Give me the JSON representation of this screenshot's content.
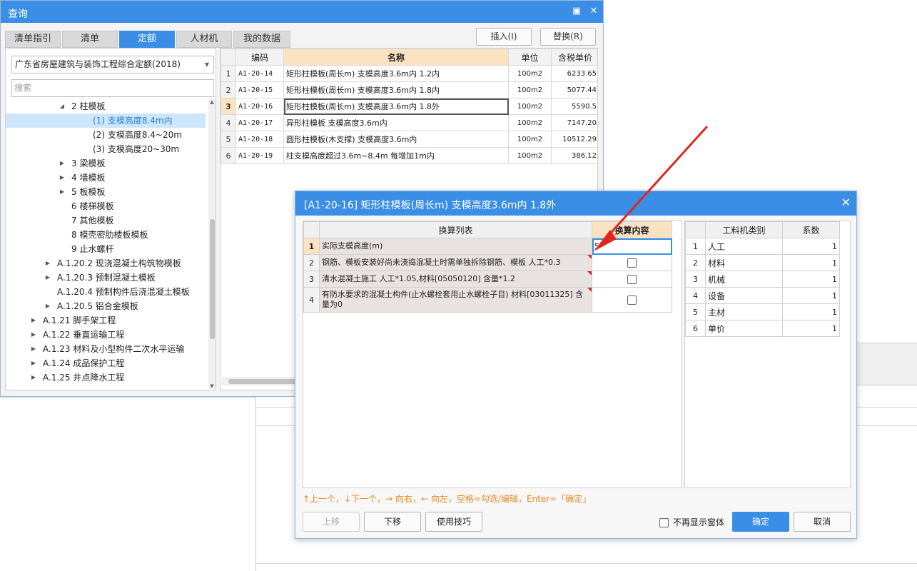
{
  "query_window": {
    "title": "查询",
    "min_icon": "▣",
    "close_icon": "✕",
    "tabs": [
      {
        "label": "清单指引"
      },
      {
        "label": "清单"
      },
      {
        "label": "定额"
      },
      {
        "label": "人材机"
      },
      {
        "label": "我的数据"
      }
    ],
    "active_tab": "定额",
    "insert_button": "插入(I)",
    "replace_button": "替换(R)",
    "quota_library": "广东省房屋建筑与装饰工程综合定额(2018)",
    "search_placeholder": "搜索",
    "tree": [
      {
        "label": "2 柱模板",
        "expander": "◢"
      },
      {
        "label": "(1) 支模高度8.4m内",
        "expander": ""
      },
      {
        "label": "(2) 支模高度8.4~20m",
        "expander": ""
      },
      {
        "label": "(3) 支模高度20~30m",
        "expander": ""
      },
      {
        "label": "3 梁模板",
        "expander": "▶"
      },
      {
        "label": "4 墙模板",
        "expander": "▶"
      },
      {
        "label": "5 板模板",
        "expander": "▶"
      },
      {
        "label": "6 楼梯模板",
        "expander": ""
      },
      {
        "label": "7 其他模板",
        "expander": ""
      },
      {
        "label": "8 模壳密肋楼板模板",
        "expander": ""
      },
      {
        "label": "9 止水螺杆",
        "expander": ""
      },
      {
        "label": "A.1.20.2 现浇混凝土构筑物模板",
        "expander": "▶"
      },
      {
        "label": "A.1.20.3 预制混凝土模板",
        "expander": "▶"
      },
      {
        "label": "A.1.20.4 预制构件后浇混凝土模板",
        "expander": ""
      },
      {
        "label": "A.1.20.5 铝合金模板",
        "expander": "▶"
      },
      {
        "label": "A.1.21 脚手架工程",
        "expander": "▶"
      },
      {
        "label": "A.1.22 垂直运输工程",
        "expander": "▶"
      },
      {
        "label": "A.1.23 材料及小型构件二次水平运输",
        "expander": "▶"
      },
      {
        "label": "A.1.24 成品保护工程",
        "expander": "▶"
      },
      {
        "label": "A.1.25 井点降水工程",
        "expander": "▶"
      }
    ],
    "grid_headers": {
      "code": "编码",
      "name": "名称",
      "unit": "单位",
      "price": "含税单价"
    },
    "grid_rows": [
      {
        "no": "1",
        "code": "A1-20-14",
        "name": "矩形柱模板(周长m) 支模高度3.6m内 1.2内",
        "unit": "100m2",
        "price": "6233.65"
      },
      {
        "no": "2",
        "code": "A1-20-15",
        "name": "矩形柱模板(周长m) 支模高度3.6m内 1.8内",
        "unit": "100m2",
        "price": "5077.44"
      },
      {
        "no": "3",
        "code": "A1-20-16",
        "name": "矩形柱模板(周长m) 支模高度3.6m内 1.8外",
        "unit": "100m2",
        "price": "5590.5"
      },
      {
        "no": "4",
        "code": "A1-20-17",
        "name": "异形柱模板 支模高度3.6m内",
        "unit": "100m2",
        "price": "7147.20"
      },
      {
        "no": "5",
        "code": "A1-20-18",
        "name": "圆形柱模板(木支撑) 支模高度3.6m内",
        "unit": "100m2",
        "price": "10512.29"
      },
      {
        "no": "6",
        "code": "A1-20-19",
        "name": "柱支模高度超过3.6m~8.4m 每增加1m内",
        "unit": "100m2",
        "price": "386.12"
      }
    ]
  },
  "dialog": {
    "title": "[A1-20-16] 矩形柱模板(周长m) 支模高度3.6m内 1.8外",
    "close_icon": "✕",
    "conv_headers": {
      "list": "换算列表",
      "content": "换算内容"
    },
    "conv_rows": [
      {
        "no": "1",
        "desc": "实际支模高度(m)",
        "value": "5"
      },
      {
        "no": "2",
        "desc": "钢筋、模板安装好尚未浇捣混凝土时需单独拆除钢筋、模板 人工*0.3",
        "value": ""
      },
      {
        "no": "3",
        "desc": "清水混凝土施工 人工*1.05,材料[05050120] 含量*1.2",
        "value": ""
      },
      {
        "no": "4",
        "desc": "有防水要求的混凝土构件(止水螺栓套用止水螺栓子目) 材料[03011325] 含量为0",
        "value": ""
      }
    ],
    "factor_headers": {
      "type": "工料机类别",
      "coef": "系数"
    },
    "factor_rows": [
      {
        "no": "1",
        "type": "人工",
        "coef": "1"
      },
      {
        "no": "2",
        "type": "材料",
        "coef": "1"
      },
      {
        "no": "3",
        "type": "机械",
        "coef": "1"
      },
      {
        "no": "4",
        "type": "设备",
        "coef": "1"
      },
      {
        "no": "5",
        "type": "主材",
        "coef": "1"
      },
      {
        "no": "6",
        "type": "单价",
        "coef": "1"
      }
    ],
    "hint": "↑上一个，↓下一个，→ 向右，← 向左，空格=勾选/编辑，Enter=「确定」",
    "up_button": "上移",
    "down_button": "下移",
    "tips_button": "使用技巧",
    "no_show_label": "不再显示窗体",
    "ok_button": "确定",
    "cancel_button": "取消"
  },
  "colors": {
    "accent": "#3a8ee6",
    "highlight": "#fbe3c2",
    "arrow": "#e0261f",
    "hint": "#ea8a1e"
  }
}
